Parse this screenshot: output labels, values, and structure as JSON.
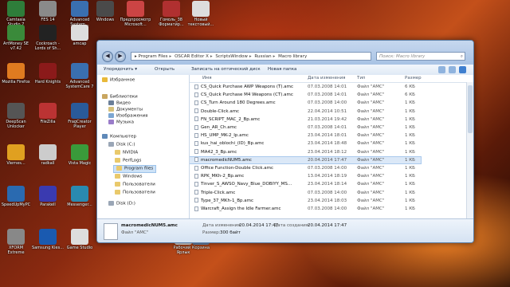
{
  "desktop_icons": [
    {
      "label": "Camtasia Studio 7"
    },
    {
      "label": "FES 14"
    },
    {
      "label": "Advanced System..."
    },
    {
      "label": "Windows"
    },
    {
      "label": "Предпросмотр Microsoft..."
    },
    {
      "label": "Гомоль_38 Форматир..."
    },
    {
      "label": "Новый текстовый..."
    },
    {
      "label": "ArtMoney SE v7.42"
    },
    {
      "label": "Cockroach - Lords of Sh..."
    },
    {
      "label": "amcap"
    },
    {
      "label": "Mozilla Firefox"
    },
    {
      "label": "Hard Knights"
    },
    {
      "label": "Advanced SystemCare 7"
    },
    {
      "label": "DeepScan Unlocker"
    },
    {
      "label": "FileZilla"
    },
    {
      "label": "FragCreator Player"
    },
    {
      "label": "Viernes..."
    },
    {
      "label": "radkall"
    },
    {
      "label": "Vista Magic"
    },
    {
      "label": "SpeedUpMyPC"
    },
    {
      "label": "Parakell"
    },
    {
      "label": "Messenger..."
    },
    {
      "label": "XFORM Extreme"
    },
    {
      "label": "Samsung Kies..."
    },
    {
      "label": "Game Studio"
    },
    {
      "label": "Рабочий - Ярлык"
    },
    {
      "label": "Корзина"
    }
  ],
  "window": {
    "address_parts": [
      "Program Files",
      "OSCAR Editor X",
      "ScriptsWindow",
      "Russian",
      "Macro library"
    ],
    "search_placeholder": "Поиск: Macro library",
    "toolbar": {
      "organize": "Упорядочить ▾",
      "open": "Открыть",
      "burn": "Записать на оптический диск",
      "new_folder": "Новая папка"
    },
    "sidebar": {
      "favorites": "Избранное",
      "libraries": "Библиотеки",
      "video": "Видео",
      "documents": "Документы",
      "images": "Изображения",
      "music": "Музыка",
      "computer": "Компьютер",
      "disk_c": "Disk (C:)",
      "folders": [
        "NVIDIA",
        "PerfLogs",
        "Program files",
        "Windows",
        "Пользователи",
        "Пользователи"
      ],
      "disk_d": "Disk (D:)"
    },
    "columns": {
      "name": "Имя",
      "date": "Дата изменения",
      "type": "Тип",
      "size": "Размер"
    },
    "files": [
      {
        "name": "CS_Quick Purchase AWP Weapons (T).amc",
        "date": "07.03.2008 14:01",
        "type": "Файл \"AMC\"",
        "size": "6 КБ"
      },
      {
        "name": "CS_Quick Purchase M4 Weapons (CT).amc",
        "date": "07.03.2008 14:01",
        "type": "Файл \"AMC\"",
        "size": "6 КБ"
      },
      {
        "name": "CS_Turn Around 180 Degrees.amc",
        "date": "07.03.2008 14:00",
        "type": "Файл \"AMC\"",
        "size": "1 КБ"
      },
      {
        "name": "Double-Click.amc",
        "date": "22.04.2014 10:51",
        "type": "Файл \"AMC\"",
        "size": "1 КБ"
      },
      {
        "name": "FN_SCRIPT_MAC_2_Bp.amc",
        "date": "21.03.2014 19:42",
        "type": "Файл \"AMC\"",
        "size": "1 КБ"
      },
      {
        "name": "Gen_AR_Ch.amc",
        "date": "07.03.2008 14:01",
        "type": "Файл \"AMC\"",
        "size": "1 КБ"
      },
      {
        "name": "HS_UMP_MK-2_Ip.amc",
        "date": "23.04.2014 18:01",
        "type": "Файл \"AMC\"",
        "size": "1 КБ"
      },
      {
        "name": "kus_hai_oblochi_(ID)_Bp.amc",
        "date": "23.04.2014 18:48",
        "type": "Файл \"AMC\"",
        "size": "1 КБ"
      },
      {
        "name": "MA42_3_Bp.amc",
        "date": "23.04.2014 18:12",
        "type": "Файл \"AMC\"",
        "size": "1 КБ"
      },
      {
        "name": "macromedicNUM5.amc",
        "date": "20.04.2014 17:47",
        "type": "Файл \"AMC\"",
        "size": "1 КБ"
      },
      {
        "name": "Office Function-Double Click.amc",
        "date": "07.03.2008 14:00",
        "type": "Файл \"AMC\"",
        "size": "1 КБ"
      },
      {
        "name": "RPK_MKh-2_Bp.amc",
        "date": "13.04.2014 18:19",
        "type": "Файл \"AMC\"",
        "size": "1 КБ"
      },
      {
        "name": "Tinver_S_AWSO_Navy_Blue_DOBIYY_MS...",
        "date": "23.04.2014 18:14",
        "type": "Файл \"AMC\"",
        "size": "1 КБ"
      },
      {
        "name": "Triple-Click.amc",
        "date": "07.03.2008 14:00",
        "type": "Файл \"AMC\"",
        "size": "1 КБ"
      },
      {
        "name": "Type_37_MKh-1_Bp.amc",
        "date": "23.04.2014 18:03",
        "type": "Файл \"AMC\"",
        "size": "1 КБ"
      },
      {
        "name": "Warcraft_Assign the Idle Farmer.amc",
        "date": "07.03.2008 14:00",
        "type": "Файл \"AMC\"",
        "size": "1 КБ"
      }
    ],
    "selected_index": 9,
    "details": {
      "name": "macromedicNUM5.amc",
      "modified_label": "Дата изменения:",
      "modified": "20.04.2014 17:47",
      "created_label": "Дата создания:",
      "created": "20.04.2014 17:47",
      "type": "Файл \"AMC\"",
      "size_label": "Размер:",
      "size": "300 байт"
    }
  }
}
